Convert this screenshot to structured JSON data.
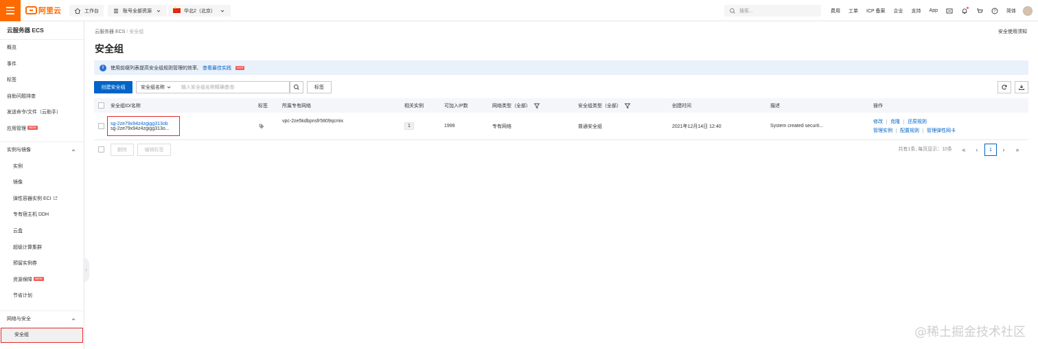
{
  "topbar": {
    "logo_text": "阿里云",
    "workbench": "工作台",
    "account_scope": "账号全部资源",
    "region": "华北2（北京）",
    "search_placeholder": "搜索...",
    "links": [
      "费用",
      "工单",
      "ICP 备案",
      "企业",
      "支持",
      "App"
    ],
    "language": "简体"
  },
  "sidebar": {
    "title": "云服务器 ECS",
    "top_items": [
      "概览",
      "事件",
      "标签",
      "自助问题排查",
      "发送命令/文件（云助手）",
      "应用管理"
    ],
    "app_mgmt_badge": "NEW",
    "group1_label": "实例与镜像",
    "group1_items": [
      "实例",
      "镜像",
      "弹性容器实例 ECI",
      "专有宿主机 DDH",
      "云盒",
      "超级计算集群",
      "预留实例券",
      "资源保障",
      "节省计划"
    ],
    "resource_badge": "NEW",
    "group2_label": "网络与安全",
    "group2_items": [
      "安全组"
    ]
  },
  "main": {
    "breadcrumb_root": "云服务器 ECS",
    "breadcrumb_sep": "/",
    "breadcrumb_current": "安全组",
    "notice_link": "安全使用须知",
    "title": "安全组",
    "tip_text": "使用前缀列表提高安全组规则管理的效率,",
    "tip_link": "查看最佳实践",
    "tip_badge": "HOT"
  },
  "toolbar": {
    "create_label": "创建安全组",
    "filter_select": "安全组名称",
    "search_placeholder": "输入安全组名称精确查询",
    "tag_label": "标签"
  },
  "table": {
    "headers": {
      "id_name": "安全组ID/名称",
      "tag": "标签",
      "vpc": "所属专有网络",
      "instances": "相关实例",
      "available_ips": "可加入IP数",
      "network_type": "网络类型（全部）",
      "sg_type": "安全组类型（全部）",
      "created": "创建时间",
      "desc": "描述",
      "ops": "操作"
    },
    "rows": [
      {
        "id": "sg-2ze79x94z4zgigg313ob",
        "name": "sg-2ze79x94z4zgigg313o...",
        "vpc": "vpc-2ze5kdbpnsfr5809qcmix",
        "instances": "1",
        "available_ips": "1999",
        "network_type": "专有网络",
        "sg_type": "普通安全组",
        "created": "2021年12月14日 12:40",
        "desc": "System created securit...",
        "ops1": [
          "修改",
          "克隆",
          "还原规则"
        ],
        "ops2": [
          "管理实例",
          "配置规则",
          "管理弹性网卡"
        ]
      }
    ]
  },
  "footer": {
    "delete_label": "删除",
    "edit_tag_label": "编辑标签",
    "pager_text": "共有1条, 每页显示：10条",
    "current_page": "1"
  },
  "watermark": "@稀土掘金技术社区"
}
